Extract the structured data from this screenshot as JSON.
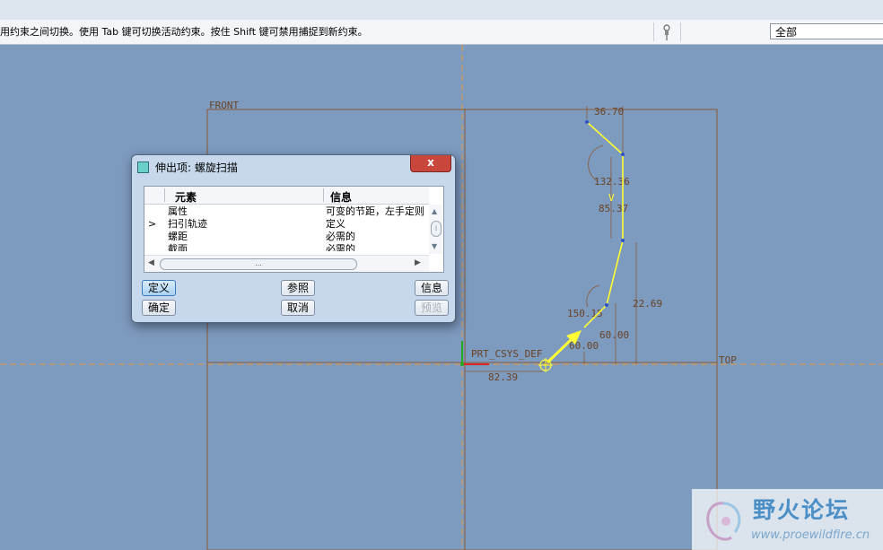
{
  "message_bar": {
    "hint": "用约束之间切换。使用 Tab 键可切换活动约束。按住 Shift 键可禁用捕捉到新约束。",
    "pin_icon": "pushpin-icon",
    "filter_value": "全部"
  },
  "sketch": {
    "ref_front": "FRONT",
    "ref_top": "TOP",
    "csys_label": "PRT_CSYS_DEF",
    "dims": [
      "36.70",
      "132.36",
      "85.37",
      "22.69",
      "150.15",
      "60.00",
      "60.00",
      "82.39"
    ],
    "constraint_v": "V",
    "colors": {
      "sketch": "#ffff33",
      "reference": "#8a5a35",
      "axis": "#e59a3c",
      "background": "#7d9abf"
    }
  },
  "dialog": {
    "title": "伸出项: 螺旋扫描",
    "close_label": "x",
    "columns": [
      "元素",
      "信息"
    ],
    "rows": [
      {
        "marker": "",
        "element": "属性",
        "info": "可变的节距，左手定则"
      },
      {
        "marker": ">",
        "element": "扫引轨迹",
        "info": "定义"
      },
      {
        "marker": "",
        "element": "螺距",
        "info": "必需的"
      },
      {
        "marker": "",
        "element": "截面",
        "info": "必需的"
      }
    ],
    "scroll_grip": "...",
    "buttons": {
      "define": "定义",
      "refs": "参照",
      "info": "信息",
      "ok": "确定",
      "cancel": "取消",
      "preview": "预览"
    }
  },
  "watermark": {
    "title": "野火论坛",
    "url": "www.proewildfire.cn"
  }
}
